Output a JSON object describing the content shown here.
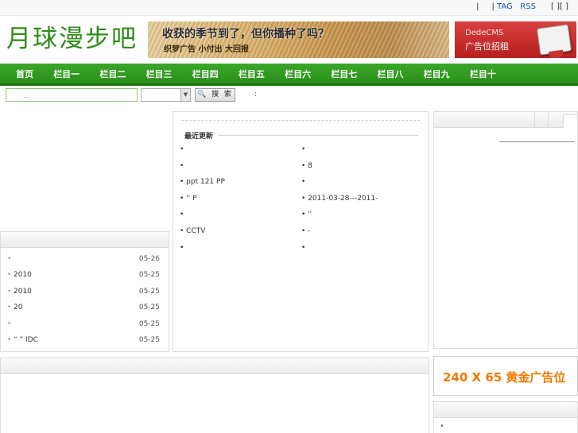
{
  "topbar": {
    "sep1": "|",
    "sep2": "|",
    "tag": "TAG",
    "rss": "RSS",
    "brackets": "[ ][ ]"
  },
  "header": {
    "logo_text": "月球漫步吧",
    "banner_left": {
      "headline": "收获的季节到了，但你播种了吗？",
      "subline": "织梦广告  小付出  大回报"
    },
    "banner_right": {
      "line1": "DedeCMS",
      "line2": "广告位招租"
    }
  },
  "nav": {
    "items": [
      "首页",
      "栏目一",
      "栏目二",
      "栏目三",
      "栏目四",
      "栏目五",
      "栏目六",
      "栏目七",
      "栏目八",
      "栏目九",
      "栏目十"
    ]
  },
  "search": {
    "placeholder": "...",
    "button_label": "搜 索",
    "hint": ":"
  },
  "left_list": {
    "items": [
      {
        "bullet": "•",
        "title": "",
        "date": "05-26"
      },
      {
        "bullet": "•",
        "title": "2010",
        "date": "05-25"
      },
      {
        "bullet": "•",
        "title": "2010",
        "date": "05-25"
      },
      {
        "bullet": "•",
        "title": "20",
        "date": "05-25"
      },
      {
        "bullet": "•",
        "title": "",
        "date": "05-25"
      },
      {
        "bullet": "•",
        "title": "“ ” IDC",
        "date": "05-25"
      }
    ]
  },
  "center": {
    "title": "最近更新",
    "col1": [
      "•",
      "•",
      "• ppt 121 PP",
      "• '' P",
      "•",
      "• CCTV",
      "•"
    ],
    "col2": [
      "•",
      "• 8",
      "•",
      "• 2011-03-28---2011-",
      "• ''",
      "• -",
      "•"
    ]
  },
  "ad": {
    "text": "240 X 65 黄金广告位",
    "color": "#f07a00"
  },
  "right2": {
    "bullet": "•"
  },
  "colors": {
    "nav_green": "#2a8f1a",
    "logo_green": "#2f8c1a",
    "banner_red": "#c82a29"
  }
}
